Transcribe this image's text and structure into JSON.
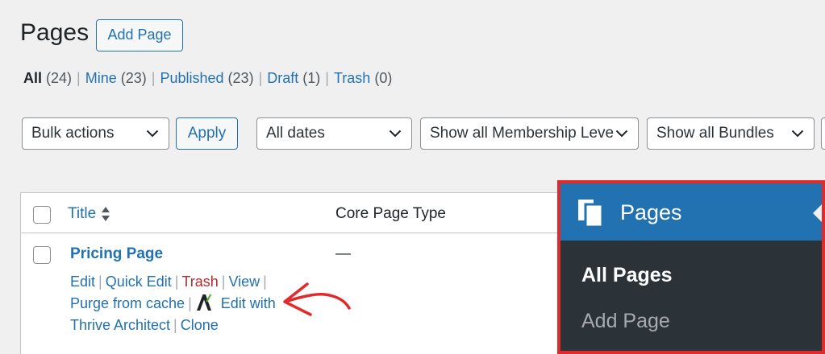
{
  "header": {
    "title": "Pages",
    "add_button": "Add Page"
  },
  "filters": {
    "all": {
      "label": "All",
      "count": "(24)"
    },
    "mine": {
      "label": "Mine",
      "count": "(23)"
    },
    "published": {
      "label": "Published",
      "count": "(23)"
    },
    "draft": {
      "label": "Draft",
      "count": "(1)"
    },
    "trash": {
      "label": "Trash",
      "count": "(0)"
    },
    "separator": "|"
  },
  "toolbar": {
    "bulk_actions": "Bulk actions",
    "apply": "Apply",
    "dates": "All dates",
    "membership": "Show all Membership Levels",
    "bundles": "Show all Bundles"
  },
  "table": {
    "columns": {
      "title": "Title",
      "core_page_type": "Core Page Type"
    },
    "rows": [
      {
        "title": "Pricing Page",
        "core_page_type": "—",
        "actions": {
          "edit": "Edit",
          "quick_edit": "Quick Edit",
          "trash": "Trash",
          "view": "View",
          "purge": "Purge from cache",
          "edit_with": "Edit with",
          "thrive": "Thrive Architect",
          "clone": "Clone"
        }
      }
    ]
  },
  "flyout": {
    "menu_title": "Pages",
    "items": [
      "All Pages",
      "Add Page"
    ]
  },
  "colors": {
    "link": "#2271b1",
    "highlight_border": "#e12a2b",
    "menu_active": "#2271b1",
    "menu_bg": "#2c3338",
    "trash": "#b32d2e"
  },
  "icons": [
    "pages-icon",
    "chevron-down-icon",
    "sort-icon",
    "thrive-architect-icon",
    "annotation-arrow-icon"
  ]
}
